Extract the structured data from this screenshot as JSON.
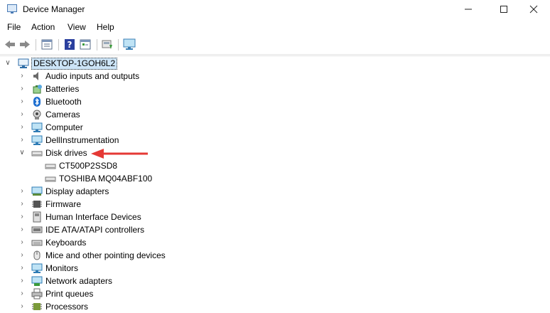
{
  "window": {
    "title": "Device Manager",
    "minimize_icon": "minimize-icon",
    "maximize_icon": "maximize-icon",
    "close_icon": "close-icon"
  },
  "menu": [
    "File",
    "Action",
    "View",
    "Help"
  ],
  "toolbar": {
    "buttons": [
      "back-icon",
      "forward-icon",
      "properties-icon",
      "help-icon",
      "show-hidden-icon",
      "update-driver-icon",
      "scan-hardware-icon"
    ]
  },
  "tree": {
    "root": "DESKTOP-1GOH6L2",
    "categories": [
      {
        "label": "Audio inputs and outputs",
        "icon": "speaker-icon"
      },
      {
        "label": "Batteries",
        "icon": "battery-icon"
      },
      {
        "label": "Bluetooth",
        "icon": "bluetooth-icon"
      },
      {
        "label": "Cameras",
        "icon": "camera-icon"
      },
      {
        "label": "Computer",
        "icon": "monitor-icon"
      },
      {
        "label": "DellInstrumentation",
        "icon": "monitor-icon"
      },
      {
        "label": "Disk drives",
        "icon": "disk-drive-icon",
        "expanded": true
      },
      {
        "label": "Display adapters",
        "icon": "display-adapter-icon"
      },
      {
        "label": "Firmware",
        "icon": "chip-icon"
      },
      {
        "label": "Human Interface Devices",
        "icon": "hid-icon"
      },
      {
        "label": "IDE ATA/ATAPI controllers",
        "icon": "ide-controller-icon"
      },
      {
        "label": "Keyboards",
        "icon": "keyboard-icon"
      },
      {
        "label": "Mice and other pointing devices",
        "icon": "mouse-icon"
      },
      {
        "label": "Monitors",
        "icon": "monitor-icon"
      },
      {
        "label": "Network adapters",
        "icon": "network-icon"
      },
      {
        "label": "Print queues",
        "icon": "printer-icon"
      },
      {
        "label": "Processors",
        "icon": "processor-icon"
      }
    ],
    "disk_drives": [
      "CT500P2SSD8",
      "TOSHIBA MQ04ABF100"
    ]
  },
  "annotation": {
    "color": "#e53935",
    "icon": "red-arrow-pointer"
  }
}
